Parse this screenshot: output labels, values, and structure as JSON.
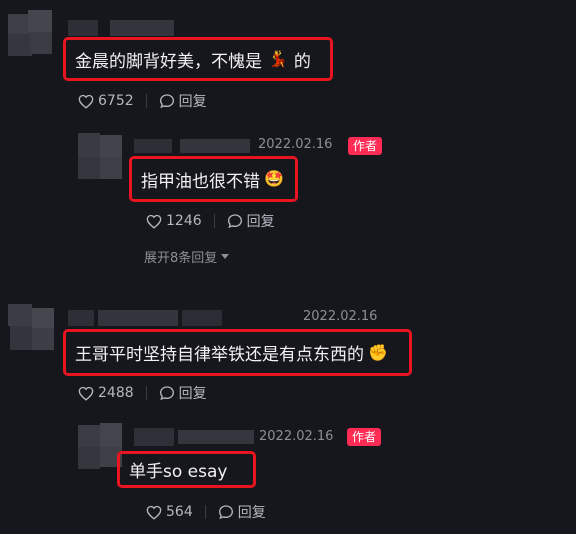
{
  "comments": [
    {
      "text": "金晨的脚背好美，不愧是",
      "text_tail": "的",
      "inline_emoji": "💃",
      "likes": "6752",
      "reply_label": "回复"
    },
    {
      "date": "2022.02.16",
      "author_tag": "作者",
      "text": "指甲油也很不错",
      "inline_emoji": "🤩",
      "likes": "1246",
      "reply_label": "回复",
      "expand_label": "展开8条回复"
    },
    {
      "date": "2022.02.16",
      "text": "王哥平时坚持自律举铁还是有点东西的",
      "inline_emoji": "✊",
      "likes": "2488",
      "reply_label": "回复"
    },
    {
      "date": "2022.02.16",
      "author_tag": "作者",
      "text": "单手so esay",
      "likes": "564",
      "reply_label": "回复"
    }
  ],
  "colors": {
    "background": "#16161d",
    "highlight_border": "#e8141f",
    "author_tag": "#fe2c55"
  },
  "icons": [
    "heart-icon",
    "reply-bubble-icon",
    "caret-down-icon"
  ]
}
